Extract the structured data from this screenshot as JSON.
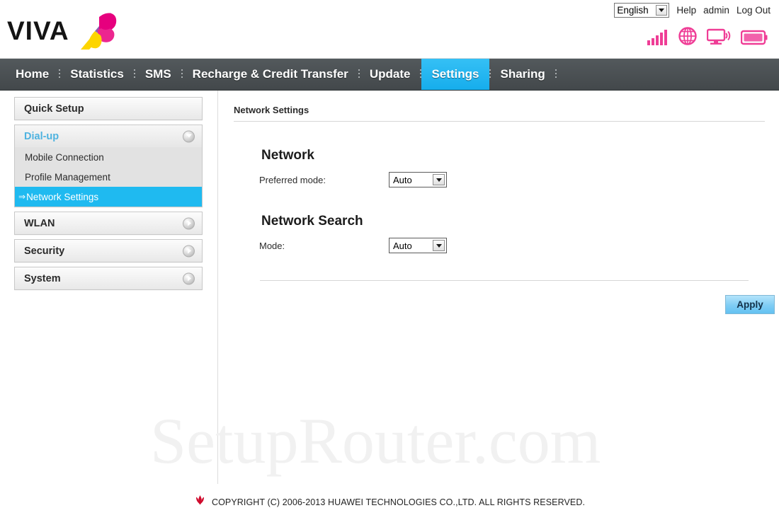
{
  "header": {
    "brand_name": "VIVA",
    "brand_colors": {
      "magenta": "#e6007e",
      "pink": "#ec268f",
      "yellow": "#fdd500",
      "purple": "#8a5fb0"
    },
    "language": {
      "selected": "English",
      "icon": "chevron-down-icon"
    },
    "help_label": "Help",
    "user_label": "admin",
    "logout_label": "Log Out",
    "status_icons": [
      {
        "name": "signal-bars-icon",
        "color": "#ef3d96"
      },
      {
        "name": "globe-icon",
        "color": "#ef3d96"
      },
      {
        "name": "monitor-wifi-icon",
        "color": "#ef3d96"
      },
      {
        "name": "battery-icon",
        "color": "#ef3d96"
      }
    ]
  },
  "nav": {
    "active": "Settings",
    "active_color": "#1fbaf0",
    "bar_color": "#4a4f52",
    "items": [
      {
        "label": "Home"
      },
      {
        "label": "Statistics"
      },
      {
        "label": "SMS"
      },
      {
        "label": "Recharge & Credit Transfer"
      },
      {
        "label": "Update"
      },
      {
        "label": "Settings"
      },
      {
        "label": "Sharing"
      }
    ]
  },
  "sidebar": {
    "quick_setup": {
      "label": "Quick Setup"
    },
    "panels": [
      {
        "label": "Dial-up",
        "expanded": true,
        "icon": "chevron-down-circle-icon",
        "items": [
          {
            "label": "Mobile Connection",
            "active": false
          },
          {
            "label": "Profile Management",
            "active": false
          },
          {
            "label": "Network Settings",
            "active": true,
            "prefix": "⇒"
          }
        ]
      },
      {
        "label": "WLAN",
        "expanded": false,
        "icon": "chevron-right-circle-icon",
        "items": []
      },
      {
        "label": "Security",
        "expanded": false,
        "icon": "chevron-right-circle-icon",
        "items": []
      },
      {
        "label": "System",
        "expanded": false,
        "icon": "chevron-right-circle-icon",
        "items": []
      }
    ]
  },
  "main": {
    "page_title": "Network Settings",
    "sections": [
      {
        "heading": "Network",
        "rows": [
          {
            "label": "Preferred mode:",
            "value": "Auto",
            "control": "select"
          }
        ]
      },
      {
        "heading": "Network Search",
        "rows": [
          {
            "label": "Mode:",
            "value": "Auto",
            "control": "select"
          }
        ]
      }
    ],
    "apply_label": "Apply"
  },
  "watermark": {
    "text": "SetupRouter.com"
  },
  "footer": {
    "logo": "huawei-flower-icon",
    "copyright": "COPYRIGHT (C) 2006-2013 HUAWEI TECHNOLOGIES CO.,LTD. ALL RIGHTS RESERVED."
  }
}
